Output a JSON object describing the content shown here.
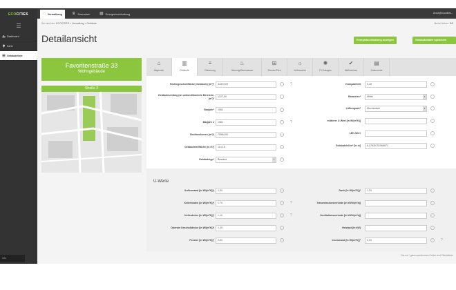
{
  "app": {
    "logo_prefix": "ECO",
    "logo_suffix": "CITIES"
  },
  "sidebar": {
    "items": [
      {
        "label": "Dashboard",
        "icon": "bar-chart-icon"
      },
      {
        "label": "Karte",
        "icon": "map-pin-icon"
      },
      {
        "label": "Gebäudeliste",
        "icon": "list-icon"
      }
    ],
    "bottom_label": "Info"
  },
  "topbar": {
    "tabs": [
      {
        "label": "Verwaltung",
        "icon": "home-icon"
      },
      {
        "label": "Szenarien",
        "icon": "trophy-icon"
      },
      {
        "label": "Energiebuchhaltung",
        "icon": "calendar-icon"
      }
    ],
    "user": "Anna@ecocities..."
  },
  "breadcrumb": {
    "prefix": "Sie sind hier:",
    "path": "ECOCITIES > Verwaltung > Gebäude"
  },
  "account": {
    "label": "Meine Nutzer:",
    "value": "BS"
  },
  "page": {
    "title": "Detailansicht"
  },
  "actions": {
    "energy_button": "Energiebuchhaltung anzeigen",
    "save_button": "Gebäudedaten speichern"
  },
  "building": {
    "address": "Favoritenstraße 33",
    "type": "Wohngebäude"
  },
  "map": {
    "title": "Straße 3"
  },
  "section_tabs": [
    {
      "label": "Allgemein",
      "icon": "home-icon"
    },
    {
      "label": "Gebäude",
      "icon": "building-icon"
    },
    {
      "label": "Dämmung",
      "icon": "insulation-icon"
    },
    {
      "label": "Heizung/Warmwasser",
      "icon": "flame-icon"
    },
    {
      "label": "Fenster/Türe",
      "icon": "window-icon"
    },
    {
      "label": "Verbraucher",
      "icon": "bulb-icon"
    },
    {
      "label": "PV Anlagen",
      "icon": "sun-icon"
    },
    {
      "label": "Maßnahmen",
      "icon": "check-icon"
    },
    {
      "label": "Dokumente",
      "icon": "document-icon"
    }
  ],
  "fields_left": [
    {
      "label": "Bruttogeschoßfläche (Gebäude) [m²]*",
      "value": "34323,00",
      "q": true
    },
    {
      "label": "Gebäudeumfang (an unkonditionierte Bereiche, [m²]*",
      "value": "1227,00",
      "q": false
    },
    {
      "label": "Baujahr*",
      "value": "1961",
      "q": false
    },
    {
      "label": "Baujahr 2",
      "value": "1961",
      "q": true
    },
    {
      "label": "Bruttovolumen [m³]*",
      "value": "75584,00",
      "q": false
    },
    {
      "label": "Gebäudeteilfläche (in m²)",
      "value": "114,16",
      "q": false
    },
    {
      "label": "Gebäudetyp*",
      "value": "Bestand",
      "q": false,
      "select": true
    }
  ],
  "fields_right": [
    {
      "label": "Kompaktheit",
      "value": "0,46",
      "select": false
    },
    {
      "label": "Bauweise*",
      "value": "Mittel",
      "select": true
    },
    {
      "label": "Lüftungsart*",
      "value": "Mechanisch",
      "select": true
    },
    {
      "label": "mittlerer U-Wert [in W/(m²K)]",
      "value": "",
      "select": false
    },
    {
      "label": "LEK-Wert",
      "value": "",
      "select": false
    },
    {
      "label": "Gebäudehöhe* [in m]",
      "value": "6,27830751568871",
      "select": false
    }
  ],
  "uwerte": {
    "title": "U-Werte",
    "left": [
      {
        "label": "Außenwand [in W/(m²K)]*",
        "value": "1,00",
        "q": false
      },
      {
        "label": "Kellerboden [in W/(m²K)]*",
        "value": "1,70",
        "q": true
      },
      {
        "label": "Kellerdecke [in W/(m²K)]*",
        "value": "1,10",
        "q": true
      },
      {
        "label": "Oberste Geschoßdecke [in W/(m²K)]*",
        "value": "1,35",
        "q": false
      },
      {
        "label": "Fenster [in W/(m²K)]*",
        "value": "2,50",
        "q": false
      }
    ],
    "right": [
      {
        "label": "Dach [in W/(m²K)]*",
        "value": "1,20",
        "q": false
      },
      {
        "label": "Transmissionsverluste [in kWh/(m²a)]",
        "value": "",
        "q": false
      },
      {
        "label": "Ventilationsverluste [in kWh/(m²a)]",
        "value": "",
        "q": false
      },
      {
        "label": "Heiztact [in kW]",
        "value": "",
        "q": false
      },
      {
        "label": "Innenwand [in W/(m²K)]*",
        "value": "2,00",
        "q": true
      }
    ]
  },
  "footnote": "Die mit * gekennzeichneten Felder sind Pflichtfelder",
  "colors": {
    "accent": "#8cc63f",
    "dark": "#333333"
  }
}
